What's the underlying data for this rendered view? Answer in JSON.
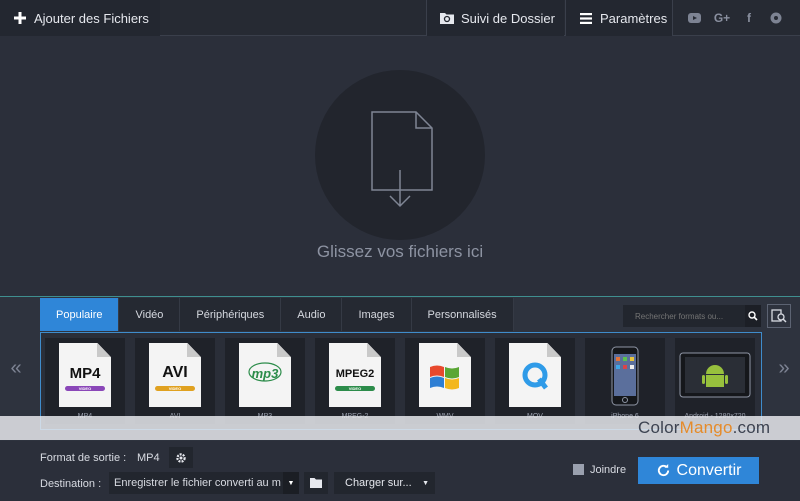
{
  "topbar": {
    "add_files_label": "Ajouter des Fichiers",
    "folder_watch_label": "Suivi de Dossier",
    "settings_label": "Paramètres",
    "social": [
      "youtube-icon",
      "google-plus-icon",
      "facebook-icon",
      "vk-icon"
    ],
    "google_plus_text": "G+",
    "facebook_text": "f"
  },
  "dropzone": {
    "text": "Glissez vos fichiers ici"
  },
  "tabs": [
    "Populaire",
    "Vidéo",
    "Périphériques",
    "Audio",
    "Images",
    "Personnalisés"
  ],
  "active_tab": "Populaire",
  "search": {
    "placeholder": "Rechercher formats ou..."
  },
  "formats": [
    {
      "label": "MP4",
      "badge": "MP4",
      "sub": "VIDEO",
      "sub_color": "#8a47b8"
    },
    {
      "label": "AVI",
      "badge": "AVI",
      "sub": "VIDEO",
      "sub_color": "#e0a120"
    },
    {
      "label": "MP3",
      "badge": "mp3",
      "sub": "",
      "sub_color": "#2c8c4a"
    },
    {
      "label": "MPEG-2",
      "badge": "MPEG2",
      "sub": "VIDEO",
      "sub_color": "#2c8c4a"
    },
    {
      "label": "WMV",
      "badge": "",
      "sub": "",
      "sub_color": ""
    },
    {
      "label": "MOV",
      "badge": "",
      "sub": "",
      "sub_color": ""
    },
    {
      "label": "iPhone 6",
      "badge": "",
      "sub": "",
      "sub_color": ""
    },
    {
      "label": "Android - 1280x720",
      "badge": "",
      "sub": "",
      "sub_color": ""
    }
  ],
  "nav": {
    "prev": "«",
    "next": "»"
  },
  "watermark": {
    "part1": "Color",
    "part2": "Mango",
    "part3": ".com"
  },
  "bottom": {
    "output_format_label": "Format de sortie :",
    "output_format_value": "MP4",
    "destination_label": "Destination :",
    "destination_value": "Enregistrer le fichier converti au m",
    "upload_label": "Charger sur...",
    "join_label": "Joindre",
    "join_checked": false,
    "convert_label": "Convertir"
  },
  "colors": {
    "accent": "#2f86d8",
    "background": "#2b2f3a"
  }
}
